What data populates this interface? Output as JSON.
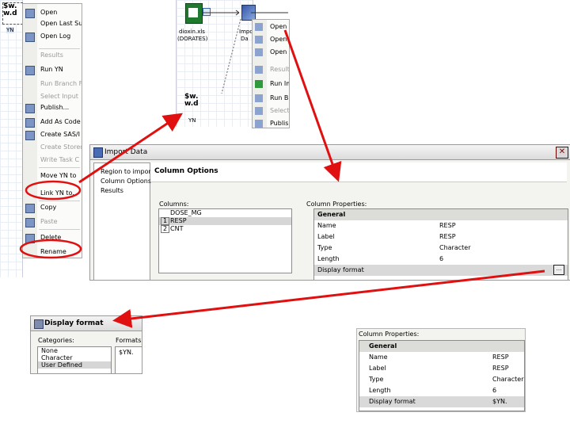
{
  "topleft": {
    "node_title": "$w.\nw.d",
    "node_tag": "YN"
  },
  "menu1": {
    "items": [
      {
        "label": "Open",
        "icon": "open-folder-icon",
        "disabled": false
      },
      {
        "label": "Open Last Sub",
        "icon": "",
        "disabled": false
      },
      {
        "label": "Open Log",
        "icon": "log-icon",
        "disabled": false
      },
      {
        "label": "Results",
        "icon": "",
        "disabled": true
      },
      {
        "label": "Run YN",
        "icon": "run-icon",
        "disabled": false
      },
      {
        "label": "Run Branch Fr",
        "icon": "",
        "disabled": true
      },
      {
        "label": "Select Input",
        "icon": "",
        "disabled": true
      },
      {
        "label": "Publish...",
        "icon": "publish-icon",
        "disabled": false
      },
      {
        "label": "Add As Code",
        "icon": "code-icon",
        "disabled": false
      },
      {
        "label": "Create SAS/I",
        "icon": "sas-icon",
        "disabled": false
      },
      {
        "label": "Create Stored",
        "icon": "",
        "disabled": true
      },
      {
        "label": "Write Task C",
        "icon": "",
        "disabled": true
      },
      {
        "label": "Move YN to",
        "icon": "",
        "disabled": false
      },
      {
        "label": "Link YN to...",
        "icon": "",
        "disabled": false
      },
      {
        "label": "Copy",
        "icon": "copy-icon",
        "disabled": false
      },
      {
        "label": "Paste",
        "icon": "paste-icon",
        "disabled": true
      },
      {
        "label": "Delete",
        "icon": "delete-icon",
        "disabled": false
      },
      {
        "label": "Rename",
        "icon": "",
        "disabled": false
      }
    ]
  },
  "flow": {
    "excel_label_1": "dioxin.xls",
    "excel_label_2": "(DORATES)",
    "import_label_1": "Impo",
    "import_label_2": "Da",
    "node2_title": "$w.\nw.d",
    "node2_tag": "YN"
  },
  "menu2": {
    "items": [
      {
        "label": "Open",
        "disabled": false
      },
      {
        "label": "Open",
        "disabled": false
      },
      {
        "label": "Open",
        "disabled": false
      },
      {
        "label": "Result",
        "disabled": true
      },
      {
        "label": "Run Im",
        "disabled": false
      },
      {
        "label": "Run Br",
        "disabled": false
      },
      {
        "label": "Select",
        "disabled": true
      },
      {
        "label": "Publis",
        "disabled": false
      }
    ]
  },
  "import_dialog": {
    "title": "Import Data",
    "close": "✕",
    "nav": [
      "Region to import",
      "Column Options",
      "Results"
    ],
    "section_title": "Column Options",
    "columns_label": "Columns:",
    "columns": [
      {
        "num": "",
        "name": "DOSE_MG",
        "selected": false
      },
      {
        "num": "1",
        "name": "RESP",
        "selected": true
      },
      {
        "num": "2",
        "name": "CNT",
        "selected": false
      }
    ],
    "props_label": "Column Properties:",
    "props_group": "General",
    "props": [
      {
        "key": "Name",
        "value": "RESP"
      },
      {
        "key": "Label",
        "value": "RESP"
      },
      {
        "key": "Type",
        "value": "Character"
      },
      {
        "key": "Length",
        "value": "6"
      },
      {
        "key": "Display format",
        "value": ""
      }
    ],
    "ellipsis": "..."
  },
  "display_format": {
    "title": "Display format",
    "categories_label": "Categories:",
    "categories": [
      "None",
      "Character",
      "User Defined"
    ],
    "formats_label": "Formats:",
    "format_value": "$YN."
  },
  "props_result": {
    "label": "Column Properties:",
    "group": "General",
    "rows": [
      {
        "key": "Name",
        "value": "RESP"
      },
      {
        "key": "Label",
        "value": "RESP"
      },
      {
        "key": "Type",
        "value": "Character"
      },
      {
        "key": "Length",
        "value": "6"
      },
      {
        "key": "Display format",
        "value": "$YN."
      }
    ]
  },
  "colors": {
    "arrow": "#e01010",
    "highlight_circle": "#e01010"
  }
}
